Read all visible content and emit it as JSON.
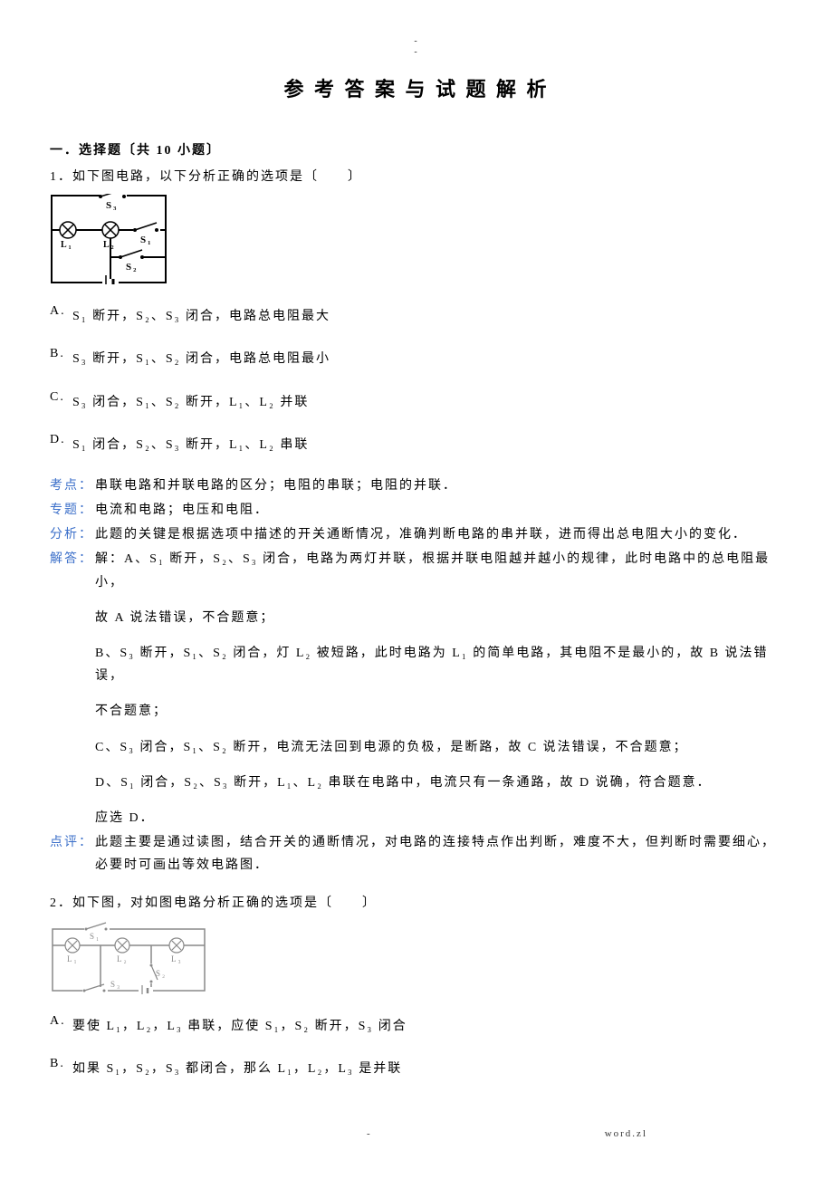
{
  "header": {
    "top_marks": "-\n-"
  },
  "title": "参 考 答 案 与 试 题 解 析",
  "section1": {
    "header": "一．选择题〔共 10 小题〕",
    "q1": {
      "text": "1．如下图电路，以下分析正确的选项是〔　　〕",
      "options": {
        "a_label": "A.",
        "a_text": "S₁ 断开，S₂、S₃ 闭合，电路总电阻最大",
        "b_label": "B.",
        "b_text": "S₃ 断开，S₁、S₂ 闭合，电路总电阻最小",
        "c_label": "C.",
        "c_text": "S₃ 闭合，S₁、S₂ 断开，L₁、L₂ 并联",
        "d_label": "D.",
        "d_text": "S₁ 闭合，S₂、S₃ 断开，L₁、L₂ 串联"
      },
      "analysis": {
        "kaodian_label": "考点：",
        "kaodian_text": "串联电路和并联电路的区分；电阻的串联；电阻的并联．",
        "zhuanti_label": "专题：",
        "zhuanti_text": "电流和电路；电压和电阻．",
        "fenxi_label": "分析：",
        "fenxi_text": "此题的关键是根据选项中描述的开关通断情况，准确判断电路的串并联，进而得出总电阻大小的变化．",
        "jieda_label": "解答：",
        "jieda_p1": "解：A、S₁ 断开，S₂、S₃ 闭合，电路为两灯并联，根据并联电阻越并越小的规律，此时电路中的总电阻最小，",
        "jieda_p2": "故 A 说法错误，不合题意；",
        "jieda_p3": "B、S₃ 断开，S₁、S₂ 闭合，灯 L₂ 被短路，此时电路为 L₁ 的简单电路，其电阻不是最小的，故 B 说法错误，",
        "jieda_p4": "不合题意；",
        "jieda_p5": "C、S₃ 闭合，S₁、S₂ 断开，电流无法回到电源的负极，是断路，故 C 说法错误，不合题意；",
        "jieda_p6": "D、S₁ 闭合，S₂、S₃ 断开，L₁、L₂ 串联在电路中，电流只有一条通路，故 D 说确，符合题意．",
        "jieda_p7": "应选 D．",
        "dianping_label": "点评：",
        "dianping_text": "此题主要是通过读图，结合开关的通断情况，对电路的连接特点作出判断，难度不大，但判断时需要细心，必要时可画出等效电路图．"
      }
    },
    "q2": {
      "text": "2．如下图，对如图电路分析正确的选项是〔　　〕",
      "options": {
        "a_label": "A.",
        "a_text": "要使 L₁，L₂，L₃ 串联，应使 S₁，S₂ 断开，S₃ 闭合",
        "b_label": "B.",
        "b_text": "如果 S₁，S₂，S₃ 都闭合，那么 L₁，L₂，L₃ 是并联"
      }
    }
  },
  "footer": {
    "left": "-",
    "right": "word.zl"
  }
}
